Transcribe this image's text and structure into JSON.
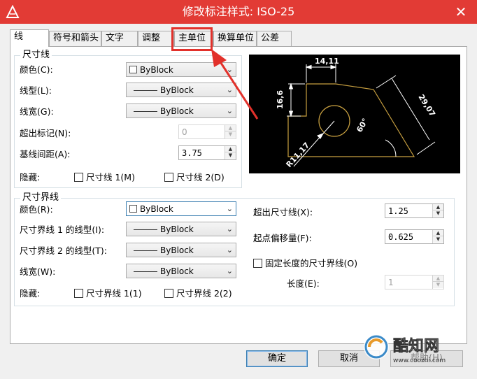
{
  "window": {
    "title": "修改标注样式: ISO-25",
    "icon": "autocad-logo-icon",
    "close_glyph": "✕"
  },
  "tabs": [
    {
      "label": "线",
      "active": true
    },
    {
      "label": "符号和箭头"
    },
    {
      "label": "文字"
    },
    {
      "label": "调整"
    },
    {
      "label": "主单位"
    },
    {
      "label": "换算单位"
    },
    {
      "label": "公差"
    }
  ],
  "dim_lines": {
    "title": "尺寸线",
    "color_label": "颜色(C):",
    "color_value": "ByBlock",
    "linetype_label": "线型(L):",
    "linetype_value": "ByBlock",
    "lineweight_label": "线宽(G):",
    "lineweight_value": "ByBlock",
    "extend_ticks_label": "超出标记(N):",
    "extend_ticks_value": "0",
    "baseline_label": "基线间距(A):",
    "baseline_value": "3.75",
    "suppress_label": "隐藏:",
    "suppress_1": "尺寸线 1(M)",
    "suppress_2": "尺寸线 2(D)"
  },
  "ext_lines": {
    "title": "尺寸界线",
    "color_label": "颜色(R):",
    "color_value": "ByBlock",
    "linetype1_label": "尺寸界线 1 的线型(I):",
    "linetype1_value": "ByBlock",
    "linetype2_label": "尺寸界线 2 的线型(T):",
    "linetype2_value": "ByBlock",
    "lineweight_label": "线宽(W):",
    "lineweight_value": "ByBlock",
    "suppress_label": "隐藏:",
    "suppress_1": "尺寸界线 1(1)",
    "suppress_2": "尺寸界线 2(2)",
    "extend_label": "超出尺寸线(X):",
    "extend_value": "1.25",
    "offset_label": "起点偏移量(F):",
    "offset_value": "0.625",
    "fixed_label": "固定长度的尺寸界线(O)",
    "length_label": "长度(E):",
    "length_value": "1"
  },
  "preview": {
    "dim_top": "14,11",
    "dim_left": "16,6",
    "dim_right": "29,07",
    "dim_angle": "60°",
    "dim_radius": "R11,17",
    "colors": {
      "bg": "#000000",
      "geometry": "#c8a040",
      "dims": "#ffffff"
    }
  },
  "buttons": {
    "ok": "确定",
    "cancel": "取消",
    "help": "帮助(H)"
  },
  "watermark": {
    "brand": "酷知网",
    "url": "www.coozhi.com"
  },
  "colors": {
    "titlebar": "#e23b35",
    "annotation": "#e2312b"
  }
}
